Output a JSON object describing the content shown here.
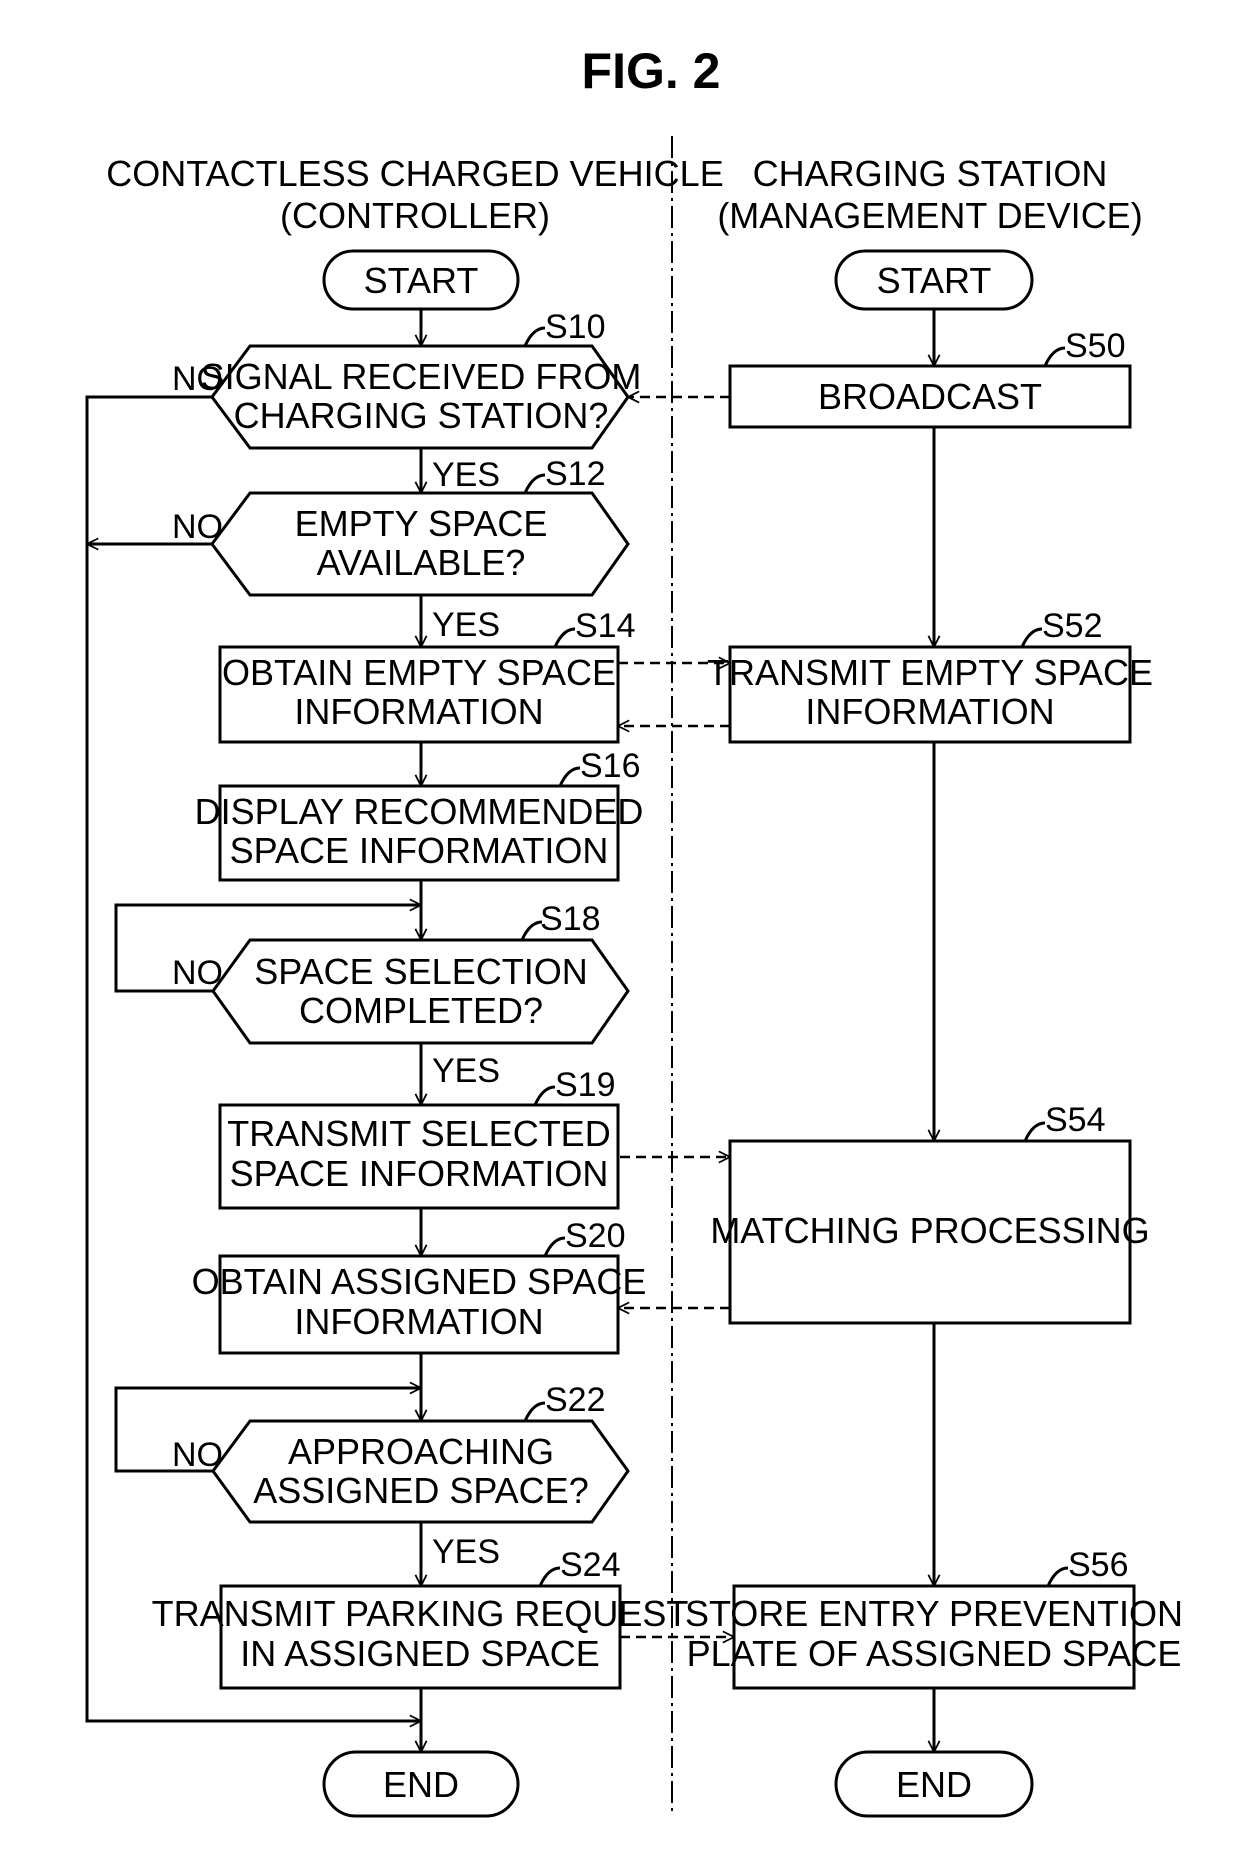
{
  "figure": {
    "title": "FIG. 2"
  },
  "lanes": {
    "left": {
      "line1": "CONTACTLESS CHARGED VEHICLE",
      "line2": "(CONTROLLER)"
    },
    "right": {
      "line1": "CHARGING STATION",
      "line2": "(MANAGEMENT DEVICE)"
    }
  },
  "terminals": {
    "left_start": "START",
    "right_start": "START",
    "left_end": "END",
    "right_end": "END"
  },
  "steps": {
    "S10": {
      "id": "S10",
      "line1": "SIGNAL RECEIVED FROM",
      "line2": "CHARGING STATION?"
    },
    "S12": {
      "id": "S12",
      "line1": "EMPTY SPACE",
      "line2": "AVAILABLE?"
    },
    "S14": {
      "id": "S14",
      "line1": "OBTAIN EMPTY SPACE",
      "line2": "INFORMATION"
    },
    "S16": {
      "id": "S16",
      "line1": "DISPLAY RECOMMENDED",
      "line2": "SPACE INFORMATION"
    },
    "S18": {
      "id": "S18",
      "line1": "SPACE SELECTION",
      "line2": "COMPLETED?"
    },
    "S19": {
      "id": "S19",
      "line1": "TRANSMIT SELECTED",
      "line2": "SPACE INFORMATION"
    },
    "S20": {
      "id": "S20",
      "line1": "OBTAIN ASSIGNED SPACE",
      "line2": "INFORMATION"
    },
    "S22": {
      "id": "S22",
      "line1": "APPROACHING",
      "line2": "ASSIGNED SPACE?"
    },
    "S24": {
      "id": "S24",
      "line1": "TRANSMIT PARKING REQUEST",
      "line2": "IN ASSIGNED SPACE"
    },
    "S50": {
      "id": "S50",
      "line1": "BROADCAST"
    },
    "S52": {
      "id": "S52",
      "line1": "TRANSMIT EMPTY SPACE",
      "line2": "INFORMATION"
    },
    "S54": {
      "id": "S54",
      "line1": "MATCHING PROCESSING"
    },
    "S56": {
      "id": "S56",
      "line1": "STORE ENTRY PREVENTION",
      "line2": "PLATE OF ASSIGNED SPACE"
    }
  },
  "conditions": {
    "yes": "YES",
    "no": "NO"
  }
}
